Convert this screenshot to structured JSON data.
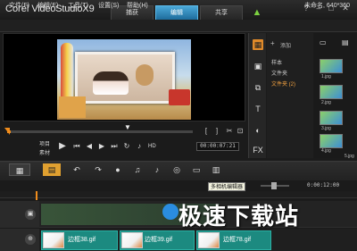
{
  "app": {
    "logo_brand": "Corel",
    "logo_product": "VideoStudio",
    "logo_version": "X9",
    "project_name": "未命名, 640*360"
  },
  "tabs": [
    {
      "label": "捕获"
    },
    {
      "label": "编辑",
      "active": true
    },
    {
      "label": "共享"
    }
  ],
  "window_buttons": [
    "?",
    "–",
    "□",
    "✕"
  ],
  "menu": [
    "文件(F)",
    "编辑(E)",
    "工具(T)",
    "设置(S)",
    "帮助(H)"
  ],
  "player": {
    "project_label": "项目",
    "clip_label": "素材",
    "hd_label": "HD",
    "timecode": "00:00:07:21",
    "trim_buttons": [
      "[",
      "]"
    ]
  },
  "library": {
    "add_label": "添加",
    "folders": [
      {
        "label": "样本"
      },
      {
        "label": "文件夹"
      },
      {
        "label": "文件夹 (2)"
      }
    ],
    "thumbs": [
      {
        "caption": "1.jpg"
      },
      {
        "caption": "2.jpg"
      },
      {
        "caption": "3.jpg"
      },
      {
        "caption": "4.jpg"
      },
      {
        "caption": "5.jpg"
      }
    ]
  },
  "timeline": {
    "tooltip": "多相机编辑器",
    "timecode": "0:00:12:00",
    "overlay_clips": [
      {
        "name": "边框38.gif"
      },
      {
        "name": "边框39.gif"
      },
      {
        "name": "边框78.gif"
      }
    ]
  },
  "watermark": {
    "text": "极速下载站"
  },
  "colors": {
    "accent_orange": "#f08c1c",
    "tab_active": "#1d6c9c",
    "overlay_clip": "#1c8a80"
  }
}
